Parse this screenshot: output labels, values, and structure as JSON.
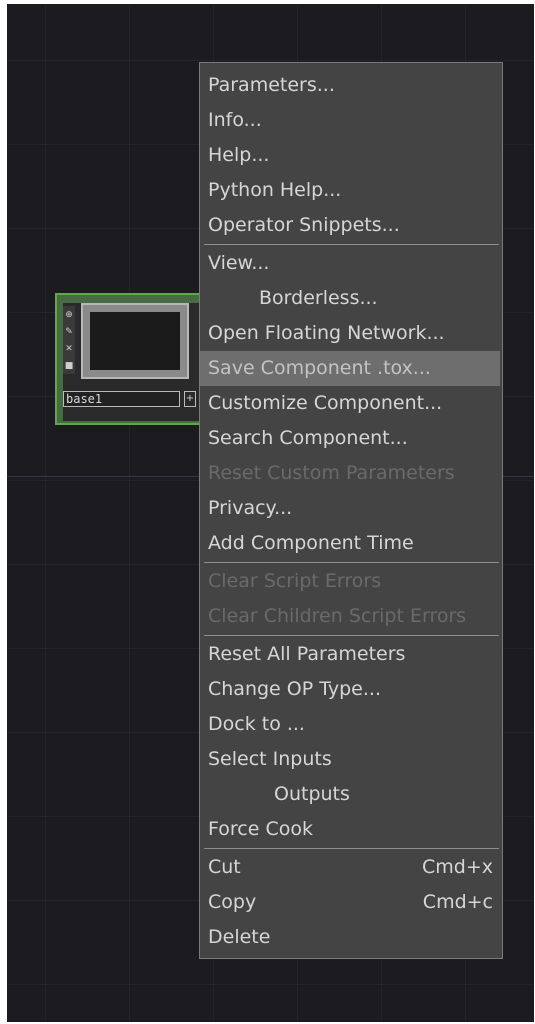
{
  "node": {
    "label": "base1",
    "plus": "+",
    "toolbar_icons": [
      "⊕",
      "✎",
      "✕",
      "■"
    ]
  },
  "menu": {
    "group1": [
      {
        "label": "Parameters..."
      },
      {
        "label": "Info..."
      },
      {
        "label": "Help..."
      },
      {
        "label": "Python Help..."
      },
      {
        "label": "Operator Snippets..."
      }
    ],
    "group2": [
      {
        "label": "View..."
      },
      {
        "label": "Borderless..."
      },
      {
        "label": "Open Floating Network..."
      },
      {
        "label": "Save Component .tox..."
      },
      {
        "label": "Customize Component..."
      },
      {
        "label": "Search Component..."
      },
      {
        "label": "Reset Custom Parameters"
      },
      {
        "label": "Privacy..."
      },
      {
        "label": "Add Component Time"
      }
    ],
    "group3": [
      {
        "label": "Clear Script Errors"
      },
      {
        "label": "Clear Children Script Errors"
      }
    ],
    "group4": [
      {
        "label": "Reset All Parameters"
      },
      {
        "label": "Change OP Type..."
      },
      {
        "label": "Dock to ..."
      },
      {
        "label": "Select Inputs"
      },
      {
        "label": "Outputs"
      },
      {
        "label": "Force Cook"
      }
    ],
    "group5": [
      {
        "label": "Cut",
        "shortcut": "Cmd+x"
      },
      {
        "label": "Copy",
        "shortcut": "Cmd+c"
      },
      {
        "label": "Delete"
      }
    ]
  },
  "colors": {
    "canvas_bg": "#1c1c20",
    "node_border": "#5fa84a",
    "menu_bg": "#444444",
    "menu_highlight": "#6e6e6e",
    "menu_text": "#d6d6d6",
    "menu_text_disabled": "#6a6a6a"
  }
}
